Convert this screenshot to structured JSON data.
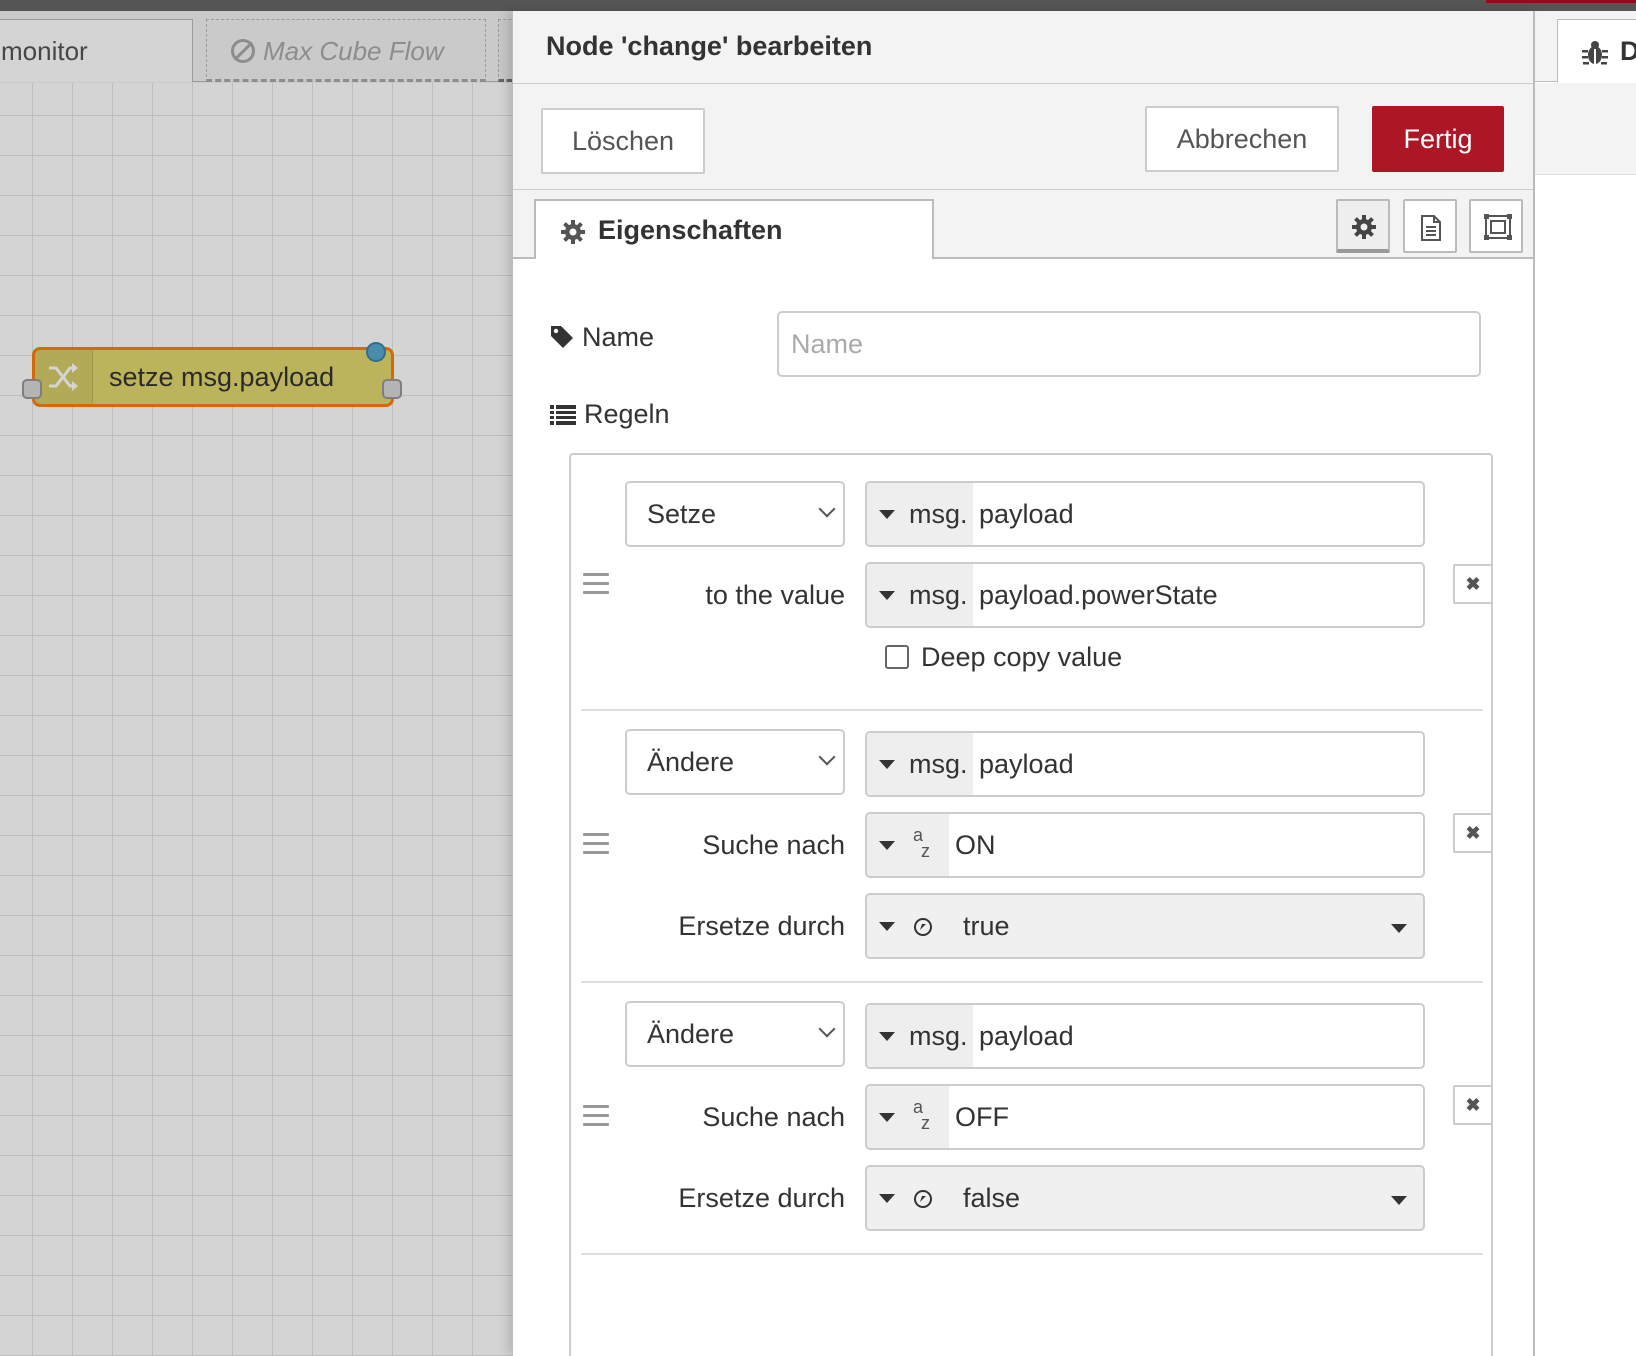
{
  "workspace": {
    "tabs": [
      {
        "label": "monitor"
      },
      {
        "label": "Max Cube Flow"
      }
    ],
    "node": {
      "label": "setze msg.payload"
    }
  },
  "editor": {
    "title": "Node 'change' bearbeiten",
    "buttons": {
      "delete": "Löschen",
      "cancel": "Abbrechen",
      "done": "Fertig"
    },
    "tab_properties": "Eigenschaften",
    "name_label": "Name",
    "name_placeholder": "Name",
    "name_value": "",
    "rules_label": "Regeln",
    "rules": [
      {
        "action": "Setze",
        "target_type": "msg.",
        "target_value": "payload",
        "value_label": "to the value",
        "value_type": "msg.",
        "value_value": "payload.powerState",
        "deep_copy_label": "Deep copy value",
        "deep_copy": false
      },
      {
        "action": "Ändere",
        "target_type": "msg.",
        "target_value": "payload",
        "search_label": "Suche nach",
        "search_value": "ON",
        "replace_label": "Ersetze durch",
        "replace_value": "true"
      },
      {
        "action": "Ändere",
        "target_type": "msg.",
        "target_value": "payload",
        "search_label": "Suche nach",
        "search_value": "OFF",
        "replace_label": "Ersetze durch",
        "replace_value": "false"
      }
    ],
    "remove_glyph": "✖"
  },
  "sidebar": {
    "tab_label": "D"
  },
  "icons": {
    "node": "shuffle-icon",
    "properties_tab": "gear-icon",
    "settings": "gear-icon",
    "description": "document-icon",
    "appearance": "frame-icon",
    "name": "tag-icon",
    "rules": "list-icon",
    "disabled_flow": "ban-icon",
    "sidebar_debug": "bug-icon"
  },
  "colors": {
    "done_button": "#ad1625",
    "node_fill": "#e2d96e",
    "node_selected_border": "#ff7f0e",
    "node_status": "#5aa9cf"
  }
}
